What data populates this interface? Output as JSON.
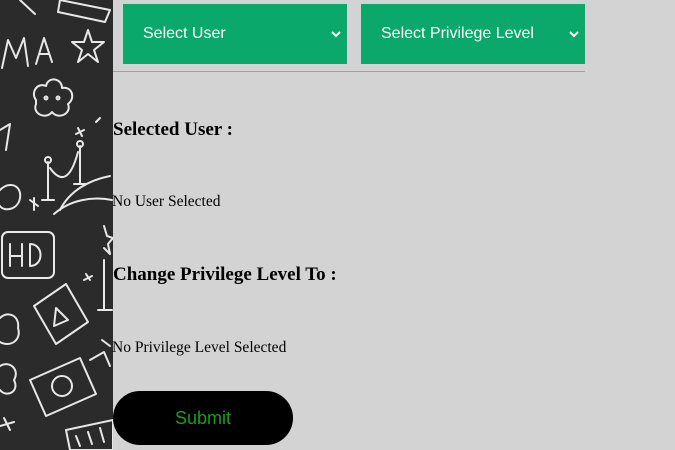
{
  "dropdowns": {
    "user": {
      "selected": "Select User",
      "icon": "chevron-down-icon"
    },
    "privilege": {
      "selected": "Select Privilege Level",
      "icon": "chevron-down-icon"
    }
  },
  "selected_user": {
    "heading": "Selected User :",
    "value": "No User Selected"
  },
  "privilege_change": {
    "heading": "Change Privilege Level To :",
    "value": "No Privilege Level Selected"
  },
  "submit_label": "Submit",
  "colors": {
    "dropdown_bg": "#0aa86b",
    "page_bg": "#d3d3d3",
    "button_bg": "#000000",
    "button_text": "#1e9b1e",
    "doodle_bg": "#2b2b2b"
  }
}
